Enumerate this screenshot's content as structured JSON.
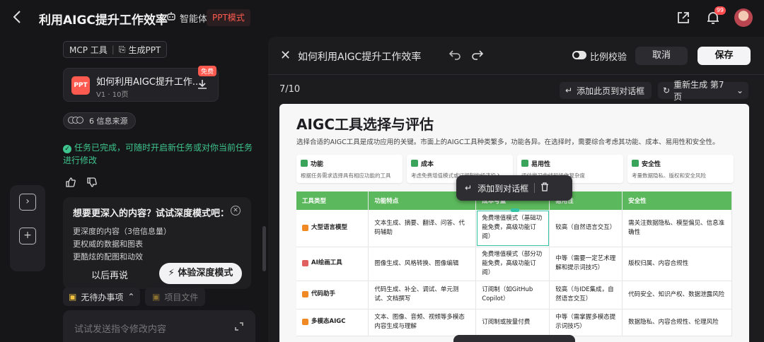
{
  "header": {
    "title": "利用AIGC提升工作效率",
    "agent_label": "智能体",
    "mode_label": "PPT模式",
    "notif_count": "99"
  },
  "chat": {
    "tool_chips": [
      "MCP 工具",
      "生成PPT"
    ],
    "ppt_card": {
      "icon_text": "PPT",
      "name": "如何利用AIGC提升工作...",
      "meta": "V1 · 10页",
      "tag": "免费"
    },
    "sources_label": "6 信息来源",
    "done_text": "任务已完成，可随时开启新任务或对你当前任务进行修改",
    "deep_mode": {
      "title": "想要更深入的内容？试试深度模式吧：",
      "lines": [
        "更深度的内容（3倍信息量）",
        "更权威的数据和图表",
        "更酷炫的配图和动效"
      ],
      "later_label": "以后再说",
      "try_label": "体验深度模式"
    },
    "todo_label": "无待办事项",
    "project_file_label": "项目文件",
    "input_placeholder": "试试发送指令修改内容"
  },
  "editor": {
    "title": "如何利用AIGC提升工作效率",
    "ratio_label": "比例校验",
    "cancel_label": "取消",
    "save_label": "保存",
    "page_indicator": "7/10",
    "add_page_label": "添加此页到对话框",
    "regen_label": "重新生成 第7页"
  },
  "slide": {
    "title": "AIGC工具选择与评估",
    "desc": "选择合适的AIGC工具是成功应用的关键。市面上的AIGC工具种类繁多，功能各异。在选择时，需要综合考虑其功能、成本、易用性和安全性。",
    "cards": [
      {
        "title": "功能",
        "desc": "根据任务需求选择具有相应功能的工具"
      },
      {
        "title": "成本",
        "desc": "考虑免费增值模式或订阅制的经济投入"
      },
      {
        "title": "易用性",
        "desc": "评估学习曲线和操作复杂度"
      },
      {
        "title": "安全性",
        "desc": "考量数据隐私、版权和安全风险"
      }
    ],
    "table": {
      "headers": [
        "工具类型",
        "功能特点",
        "成本考量",
        "易用性",
        "安全性"
      ],
      "rows": [
        [
          "大型语言模型",
          "文本生成、摘要、翻译、问答、代码辅助",
          "免费增值模式（基础功能免费，高级功能订阅）",
          "较高（自然语言交互）",
          "需关注数据隐私、模型偏见、信息准确性"
        ],
        [
          "AI绘画工具",
          "图像生成、风格转换、图像编辑",
          "免费增值模式（部分功能免费，高级功能订阅）",
          "中等（需要一定艺术理解和提示词技巧）",
          "版权归属、内容合规性"
        ],
        [
          "代码助手",
          "代码生成、补全、调试、单元测试、文档撰写",
          "订阅制（如GitHub Copilot）",
          "较高（与IDE集成，自然语言交互）",
          "代码安全、知识产权、数据泄露风险"
        ],
        [
          "多模态AIGC",
          "文本、图像、音频、视频等多模态内容生成与理解",
          "订阅制或按量付费",
          "中等（需掌握多模态提示词技巧）",
          "数据隐私、内容合规性、伦理风险"
        ]
      ]
    },
    "popover": {
      "add_label": "添加到对话框"
    }
  },
  "colors": {
    "accent": "#ff5a4f",
    "table_header": "#5cb85c",
    "success": "#3ec58e",
    "selection": "#35c3a8"
  }
}
